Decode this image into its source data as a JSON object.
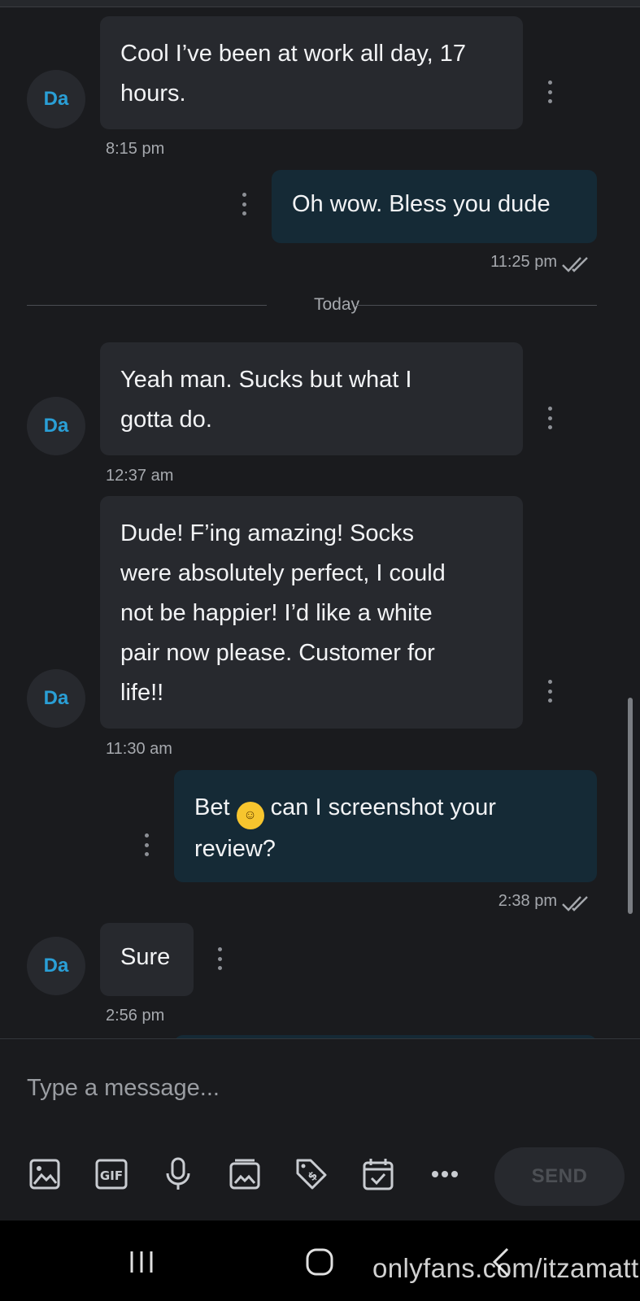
{
  "messages": [
    {
      "sender": "Da",
      "text_lines": [
        "Cool I’ve been at work all day, 17",
        "hours."
      ],
      "time": "8:15 pm"
    },
    {
      "sender": "me",
      "text_lines": [
        "Oh wow. Bless you dude"
      ],
      "time": "11:25 pm"
    },
    {
      "sender": "Da",
      "text_lines": [
        "Yeah man. Sucks but what I",
        "gotta do."
      ],
      "time": "12:37 am"
    },
    {
      "sender": "Da",
      "text_lines": [
        "Dude! F’ing amazing! Socks",
        "were absolutely perfect, I could",
        "not be happier! I’d like a white",
        "pair now please. Customer for",
        "life!!"
      ],
      "time": "11:30 am"
    },
    {
      "sender": "me",
      "text_lines_before_emoji": "Bet ",
      "emoji": "smirking-face-emoji",
      "text_lines": [
        " can I screenshot your",
        "review?"
      ],
      "time": "2:38 pm"
    },
    {
      "sender": "Da",
      "text_lines": [
        "Sure"
      ],
      "time": "2:56 pm"
    }
  ],
  "day_divider": "Today",
  "composer": {
    "placeholder": "Type a message...",
    "send_label": "SEND",
    "tools": [
      "image-icon",
      "gif-icon",
      "microphone-icon",
      "media-vault-icon",
      "price-tag-icon",
      "schedule-calendar-icon",
      "more-icon"
    ],
    "gif_label": "GIF"
  },
  "watermark": "onlyfans.com/itzamatt",
  "colors": {
    "background": "#1a1b1e",
    "incoming_bubble": "#27292e",
    "outgoing_bubble": "#152a36",
    "avatar_text": "#2a9fd6",
    "timestamp": "#a6a9ae"
  }
}
